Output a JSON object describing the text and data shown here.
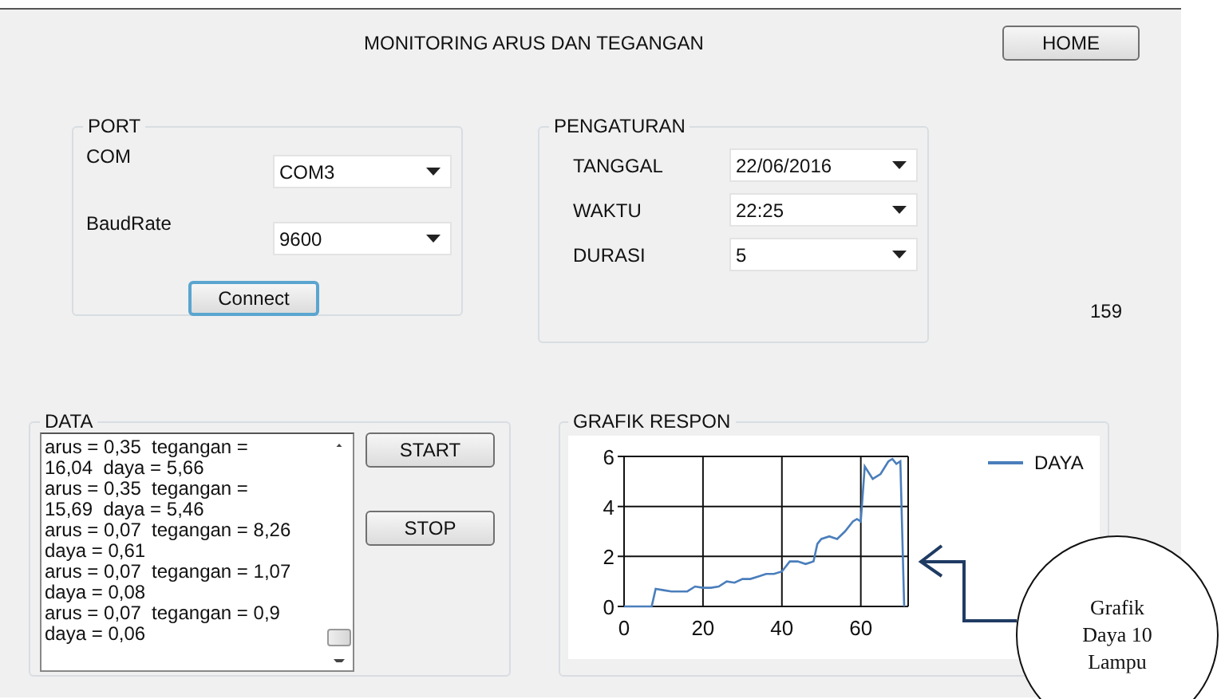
{
  "window": {
    "title": "MONITORING ARUS DAN TEGANGAN"
  },
  "home_button": {
    "label": "HOME"
  },
  "port": {
    "title": "PORT",
    "fields": [
      {
        "label": "COM",
        "value": "COM3"
      },
      {
        "label": "BaudRate",
        "value": "9600"
      }
    ],
    "connect_button": {
      "label": "Connect",
      "focused": true
    }
  },
  "pengaturan": {
    "title": "PENGATURAN",
    "fields": [
      {
        "label": "TANGGAL",
        "value": "22/06/2016"
      },
      {
        "label": "WAKTU",
        "value": "22:25"
      },
      {
        "label": "DURASI",
        "value": "5"
      }
    ]
  },
  "counter": "159",
  "data": {
    "title": "DATA",
    "lines": [
      "arus = 0,35  tegangan =",
      "16,04  daya = 5,66",
      "arus = 0,35  tegangan =",
      "15,69  daya = 5,46",
      "arus = 0,07  tegangan = 8,26",
      "daya = 0,61",
      "arus = 0,07  tegangan = 1,07",
      "daya = 0,08",
      "arus = 0,07  tegangan = 0,9",
      "daya = 0,06"
    ],
    "buttons": [
      {
        "label": "START"
      },
      {
        "label": "STOP"
      }
    ]
  },
  "grafik": {
    "title": "GRAFIK RESPON",
    "chart_data": {
      "type": "line",
      "x": [
        0,
        2,
        4,
        6,
        7,
        8,
        10,
        12,
        14,
        16,
        18,
        20,
        22,
        24,
        26,
        28,
        30,
        32,
        34,
        36,
        38,
        40,
        42,
        44,
        46,
        48,
        49,
        50,
        52,
        54,
        56,
        58,
        59,
        60,
        61,
        63,
        65,
        67,
        68,
        69,
        70,
        71
      ],
      "series": [
        {
          "name": "DAYA",
          "color": "#4a7ebb",
          "values": [
            0,
            0,
            0,
            0,
            0,
            0.7,
            0.65,
            0.6,
            0.6,
            0.6,
            0.8,
            0.75,
            0.75,
            0.8,
            1.0,
            0.95,
            1.1,
            1.1,
            1.2,
            1.3,
            1.3,
            1.4,
            1.8,
            1.8,
            1.7,
            1.8,
            2.5,
            2.7,
            2.8,
            2.7,
            3.0,
            3.4,
            3.5,
            3.4,
            5.6,
            5.1,
            5.3,
            5.8,
            5.9,
            5.7,
            5.8,
            0
          ]
        }
      ],
      "grid": true,
      "xlim": [
        0,
        72
      ],
      "ylim": [
        0,
        6
      ],
      "xticks": [
        0,
        20,
        40,
        60
      ],
      "yticks": [
        0,
        2,
        4,
        6
      ]
    }
  },
  "callout": {
    "text": "Grafik Daya 10 Lampu"
  }
}
